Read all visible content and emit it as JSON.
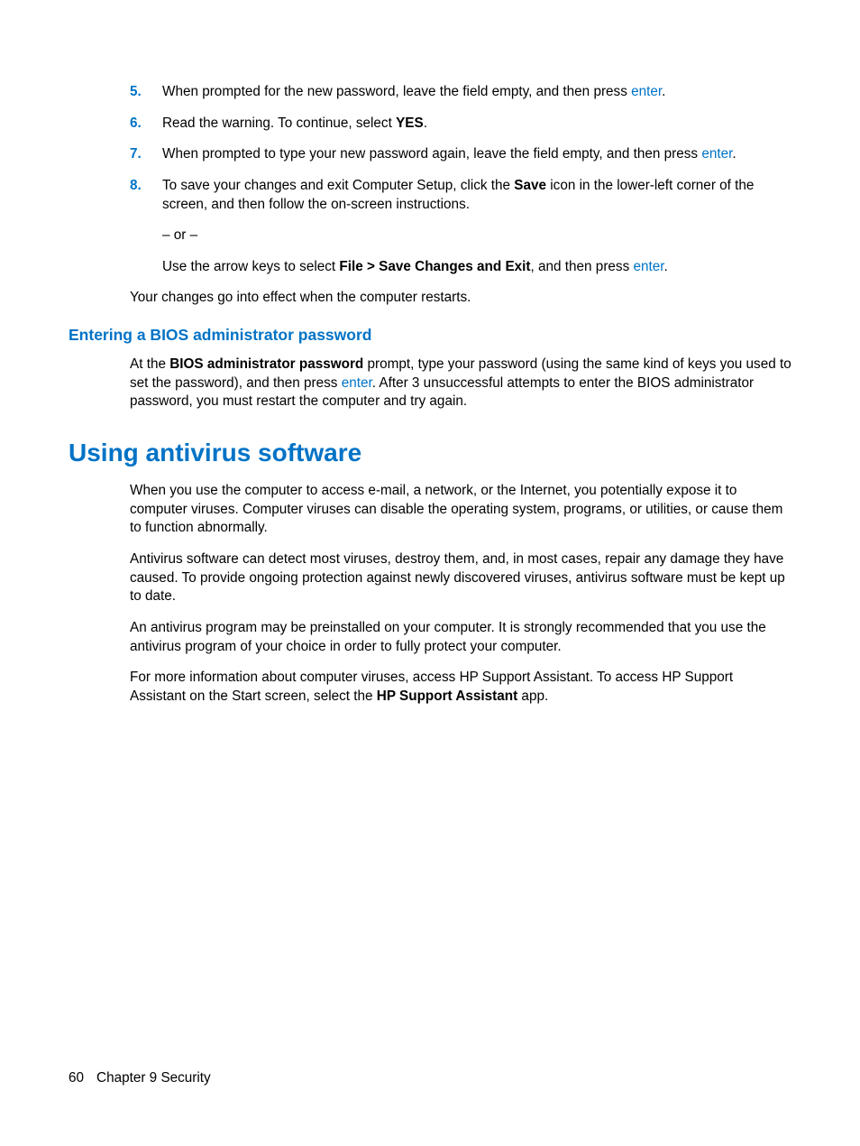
{
  "steps": {
    "s5": {
      "num": "5.",
      "t1": "When prompted for the new password, leave the field empty, and then press ",
      "link": "enter",
      "t2": "."
    },
    "s6": {
      "num": "6.",
      "t1": "Read the warning. To continue, select ",
      "b": "YES",
      "t2": "."
    },
    "s7": {
      "num": "7.",
      "t1": "When prompted to type your new password again, leave the field empty, and then press ",
      "link": "enter",
      "t2": "."
    },
    "s8": {
      "num": "8.",
      "t1": "To save your changes and exit Computer Setup, click the ",
      "b1": "Save",
      "t2": " icon in the lower-left corner of the screen, and then follow the on-screen instructions.",
      "or": "– or –",
      "t3": "Use the arrow keys to select ",
      "b2": "File > Save Changes and Exit",
      "t4": ", and then press ",
      "link": "enter",
      "t5": "."
    }
  },
  "afterSteps": "Your changes go into effect when the computer restarts.",
  "h3": "Entering a BIOS administrator password",
  "biosPara": {
    "t1": "At the ",
    "b": "BIOS administrator password",
    "t2": " prompt, type your password (using the same kind of keys you used to set the password), and then press ",
    "link": "enter",
    "t3": ". After 3 unsuccessful attempts to enter the BIOS administrator password, you must restart the computer and try again."
  },
  "h1": "Using antivirus software",
  "av": {
    "p1": "When you use the computer to access e-mail, a network, or the Internet, you potentially expose it to computer viruses. Computer viruses can disable the operating system, programs, or utilities, or cause them to function abnormally.",
    "p2": "Antivirus software can detect most viruses, destroy them, and, in most cases, repair any damage they have caused. To provide ongoing protection against newly discovered viruses, antivirus software must be kept up to date.",
    "p3": "An antivirus program may be preinstalled on your computer. It is strongly recommended that you use the antivirus program of your choice in order to fully protect your computer.",
    "p4a": "For more information about computer viruses, access HP Support Assistant. To access HP Support Assistant on the Start screen, select the ",
    "p4b": "HP Support Assistant",
    "p4c": " app."
  },
  "footer": {
    "page": "60",
    "chapter": "Chapter 9   Security"
  }
}
